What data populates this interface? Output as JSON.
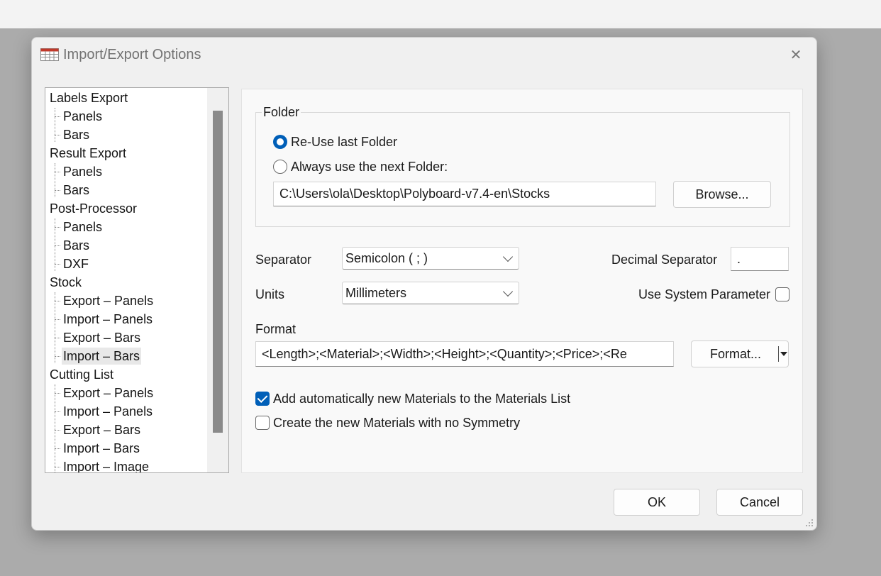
{
  "dialog": {
    "title": "Import/Export Options",
    "close_glyph": "✕",
    "icon": "spreadsheet-icon"
  },
  "tree": {
    "items": [
      {
        "label": "Labels Export",
        "level": 0
      },
      {
        "label": "Panels",
        "level": 1
      },
      {
        "label": "Bars",
        "level": 1
      },
      {
        "label": "Result Export",
        "level": 0
      },
      {
        "label": "Panels",
        "level": 1
      },
      {
        "label": "Bars",
        "level": 1
      },
      {
        "label": "Post-Processor",
        "level": 0
      },
      {
        "label": "Panels",
        "level": 1
      },
      {
        "label": "Bars",
        "level": 1
      },
      {
        "label": "DXF",
        "level": 1
      },
      {
        "label": "Stock",
        "level": 0
      },
      {
        "label": "Export – Panels",
        "level": 1
      },
      {
        "label": "Import – Panels",
        "level": 1
      },
      {
        "label": "Export – Bars",
        "level": 1
      },
      {
        "label": "Import – Bars",
        "level": 1,
        "selected": true
      },
      {
        "label": "Cutting List",
        "level": 0
      },
      {
        "label": "Export – Panels",
        "level": 1
      },
      {
        "label": "Import – Panels",
        "level": 1
      },
      {
        "label": "Export – Bars",
        "level": 1
      },
      {
        "label": "Import – Bars",
        "level": 1
      },
      {
        "label": "Import – Image",
        "level": 1
      }
    ]
  },
  "folder": {
    "group_title": "Folder",
    "option_reuse": "Re-Use last Folder",
    "option_always": "Always use the next Folder:",
    "selected_option": "reuse",
    "path": "C:\\Users\\ola\\Desktop\\Polyboard-v7.4-en\\Stocks",
    "browse_label": "Browse..."
  },
  "settings": {
    "separator_label": "Separator",
    "separator_value": "Semicolon  ( ; )",
    "decimal_label": "Decimal Separator",
    "decimal_value": ".",
    "units_label": "Units",
    "units_value": "Millimeters",
    "system_param_label": "Use System Parameter",
    "system_param_checked": false
  },
  "format": {
    "label": "Format",
    "value": "<Length>;<Material>;<Width>;<Height>;<Quantity>;<Price>;<Re",
    "button_label": "Format..."
  },
  "checkboxes": {
    "add_materials_label": "Add automatically new Materials to the Materials List",
    "add_materials_checked": true,
    "no_symmetry_label": "Create the new Materials with no Symmetry",
    "no_symmetry_checked": false
  },
  "buttons": {
    "ok": "OK",
    "cancel": "Cancel"
  },
  "colors": {
    "accent": "#005fb8",
    "dialog_bg": "#f0f0f0",
    "backdrop": "#ababab"
  }
}
